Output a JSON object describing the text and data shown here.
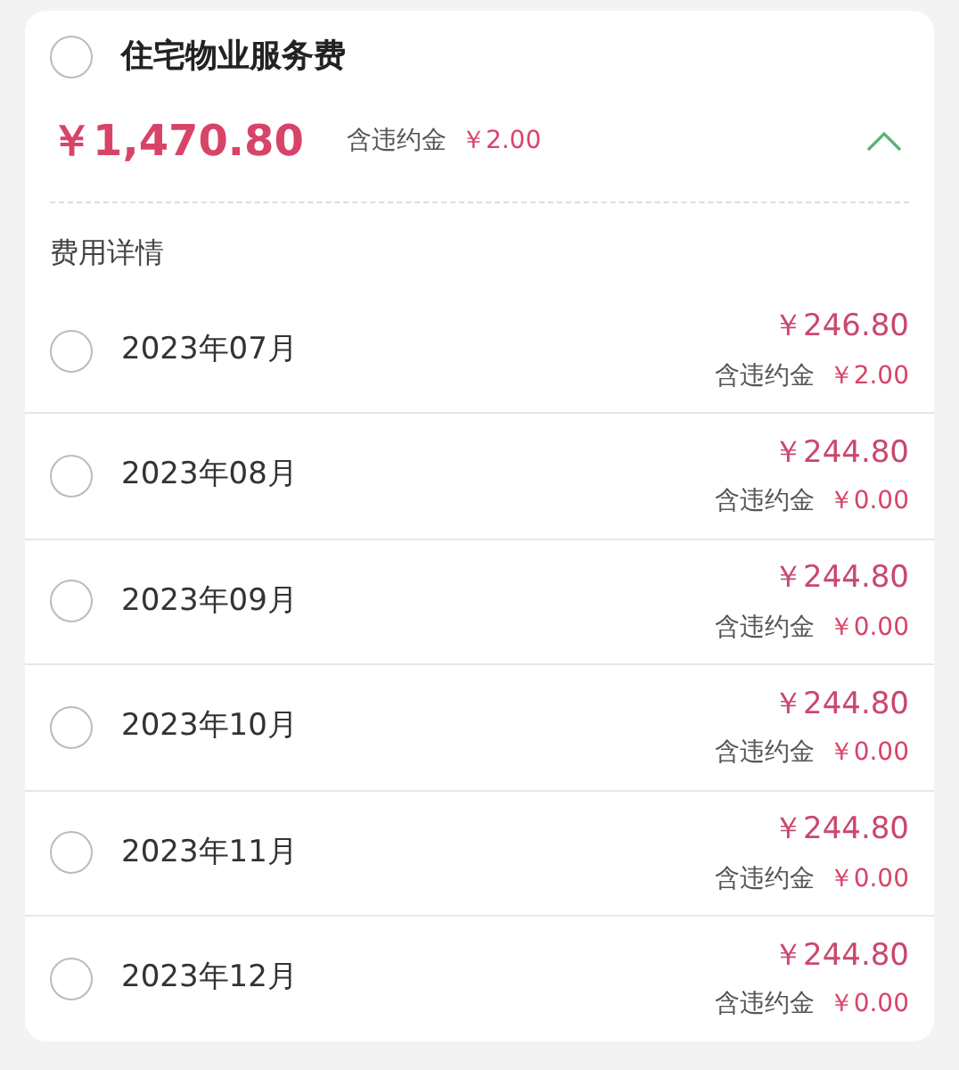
{
  "bill": {
    "title": "住宅物业服务费",
    "checked": false,
    "total": "￥1,470.80",
    "penalty_label": "含违约金",
    "penalty": "￥2.00",
    "expanded": true
  },
  "details": {
    "label": "费用详情",
    "rows": [
      {
        "month": "2023年07月",
        "checked": false,
        "amount": "￥246.80",
        "penalty_label": "含违约金",
        "penalty": "￥2.00"
      },
      {
        "month": "2023年08月",
        "checked": false,
        "amount": "￥244.80",
        "penalty_label": "含违约金",
        "penalty": "￥0.00"
      },
      {
        "month": "2023年09月",
        "checked": false,
        "amount": "￥244.80",
        "penalty_label": "含违约金",
        "penalty": "￥0.00"
      },
      {
        "month": "2023年10月",
        "checked": false,
        "amount": "￥244.80",
        "penalty_label": "含违约金",
        "penalty": "￥0.00"
      },
      {
        "month": "2023年11月",
        "checked": false,
        "amount": "￥244.80",
        "penalty_label": "含违约金",
        "penalty": "￥0.00"
      },
      {
        "month": "2023年12月",
        "checked": false,
        "amount": "￥244.80",
        "penalty_label": "含违约金",
        "penalty": "￥0.00"
      }
    ]
  }
}
